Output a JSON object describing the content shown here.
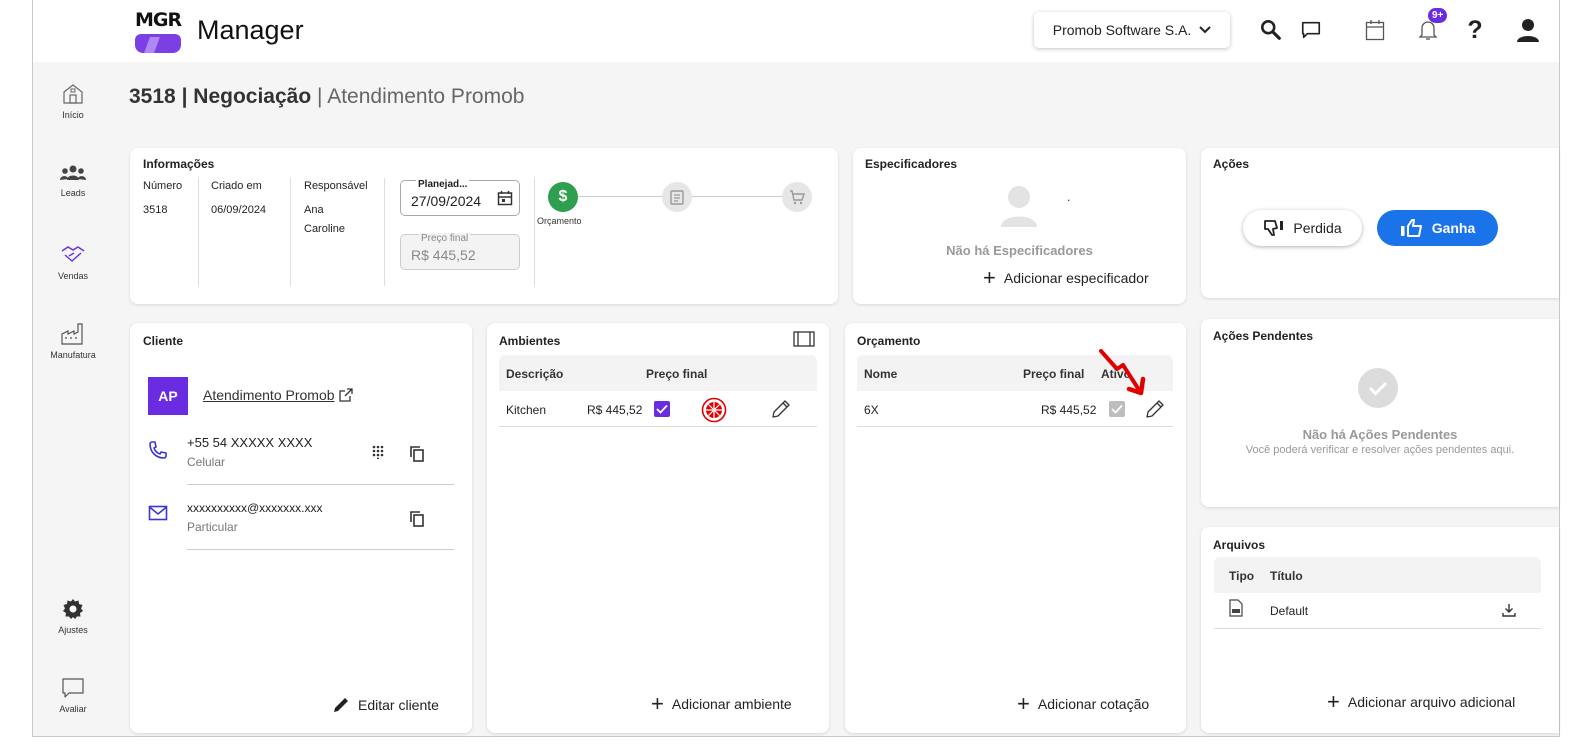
{
  "app": {
    "logo_text": "MGR",
    "title": "Manager"
  },
  "topbar": {
    "company": "Promob Software S.A.",
    "notifications_badge": "9+"
  },
  "sidebar": {
    "items": [
      {
        "label": "Início"
      },
      {
        "label": "Leads"
      },
      {
        "label": "Vendas"
      },
      {
        "label": "Manufatura"
      },
      {
        "label": "Ajustes"
      },
      {
        "label": "Avaliar"
      }
    ]
  },
  "header": {
    "id": "3518",
    "stage": "Negociação",
    "separator": "|",
    "client": "Atendimento Promob"
  },
  "info": {
    "title": "Informações",
    "col_numero": "Número",
    "numero": "3518",
    "col_criado": "Criado em",
    "criado": "06/09/2024",
    "col_responsavel": "Responsável",
    "responsavel_1": "Ana",
    "responsavel_2": "Caroline",
    "planejado_label": "Planejad...",
    "planejado_value": "27/09/2024",
    "preco_label": "Preço final",
    "preco_value": "R$ 445,52",
    "step_label": "Orçamento",
    "step_symbol": "$"
  },
  "specifiers": {
    "title": "Especificadores",
    "empty": "Não há Especificadores",
    "add": "Adicionar especificador",
    "dot": "."
  },
  "actions": {
    "title": "Ações",
    "lost": "Perdida",
    "won": "Ganha"
  },
  "client": {
    "title": "Cliente",
    "initials": "AP",
    "name": "Atendimento Promob",
    "phone": "+55 54 XXXXX XXXX",
    "phone_type": "Celular",
    "email": "xxxxxxxxxx@xxxxxxx.xxx",
    "email_type": "Particular",
    "edit": "Editar cliente"
  },
  "ambientes": {
    "title": "Ambientes",
    "col_desc": "Descrição",
    "col_preco": "Preço final",
    "rows": [
      {
        "desc": "Kitchen",
        "preco": "R$ 445,52"
      }
    ],
    "add": "Adicionar ambiente"
  },
  "orcamento": {
    "title": "Orçamento",
    "col_nome": "Nome",
    "col_preco": "Preço final",
    "col_ativo": "Ativo",
    "rows": [
      {
        "nome": "6X",
        "preco": "R$ 445,52"
      }
    ],
    "add": "Adicionar cotação"
  },
  "pendentes": {
    "title": "Ações Pendentes",
    "empty": "Não há Ações Pendentes",
    "sub": "Você poderá verificar e resolver ações pendentes aqui."
  },
  "arquivos": {
    "title": "Arquivos",
    "col_tipo": "Tipo",
    "col_titulo": "Título",
    "rows": [
      {
        "titulo": "Default"
      }
    ],
    "add": "Adicionar arquivo adicional"
  },
  "colors": {
    "accent": "#1a73e8",
    "purple": "#7b3fe4",
    "green": "#2e9e4f",
    "red": "#e00000"
  }
}
